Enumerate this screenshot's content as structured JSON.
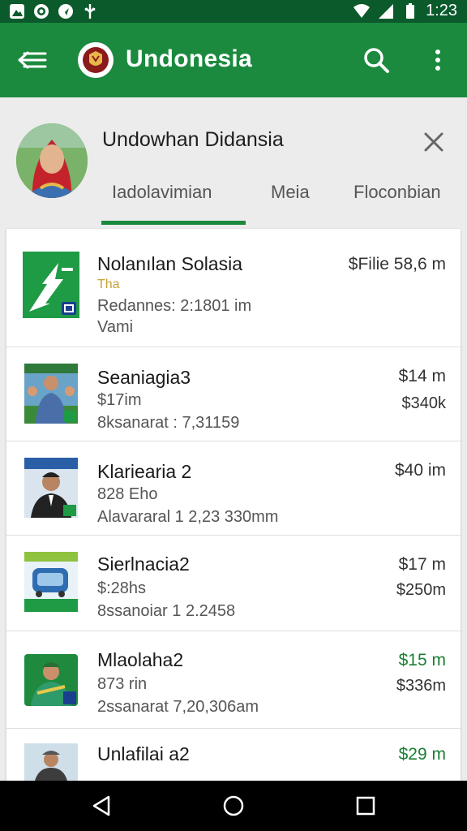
{
  "status_bar": {
    "time": "1:23"
  },
  "app_bar": {
    "title": "Undonesia"
  },
  "profile": {
    "name": "Undowhan Didansia"
  },
  "tabs": [
    {
      "label": "Iadolavimian"
    },
    {
      "label": "Meia"
    },
    {
      "label": "Floconbian"
    }
  ],
  "items": [
    {
      "title": "Nolanılan Solasia",
      "sub1": "Tha",
      "sub2": "Redannes: 2:1801 im",
      "sub3": "Vami",
      "price1": "$Filie 58,6 m",
      "price2": ""
    },
    {
      "title": "Seaniagia3",
      "sub1": "$17im",
      "sub2": "8ksanarat : 7,31159",
      "sub3": "",
      "price1": "$14 m",
      "price2": "$340k"
    },
    {
      "title": "Klariearia 2",
      "sub1": "828 Eho",
      "sub2": "Alavararal 1 2,23 330mm",
      "sub3": "",
      "price1": "$40 im",
      "price2": ""
    },
    {
      "title": "Sierlnacia2",
      "sub1": "$:28hs",
      "sub2": "8ssanoiar 1 2.2458",
      "sub3": "",
      "price1": "$17 m",
      "price2": "$250m"
    },
    {
      "title": "Mlaolaha2",
      "sub1": "873 rin",
      "sub2": "2ssanarat 7,20,306am",
      "sub3": "",
      "price1": "$15 m",
      "price2": "$336m"
    },
    {
      "title": "Unlafilai a2",
      "sub1": "",
      "sub2": "",
      "sub3": "",
      "price1": "$29 m",
      "price2": ""
    }
  ],
  "colors": {
    "primary": "#1b8a3e",
    "status_bar": "#0b5a2c",
    "price_green": "#1a7f33"
  }
}
